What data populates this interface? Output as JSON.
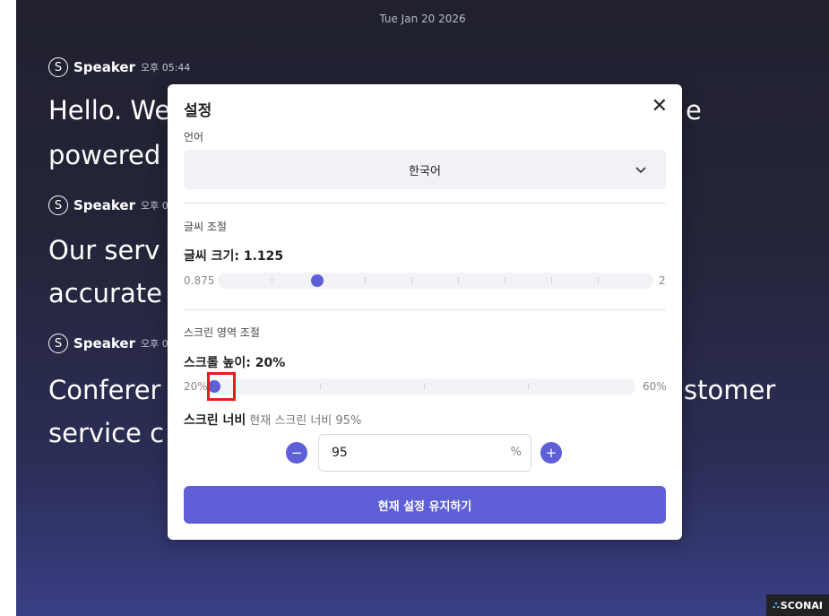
{
  "date": "Tue Jan 20 2026",
  "transcript": [
    {
      "avatar": "S",
      "speaker": "Speaker",
      "time": "오후 05:44",
      "lines": [
        "Hello. We",
        "powered"
      ],
      "line_tail": "e"
    },
    {
      "avatar": "S",
      "speaker": "Speaker",
      "time": "오후 0",
      "lines": [
        "Our serv",
        "accurate"
      ]
    },
    {
      "avatar": "S",
      "speaker": "Speaker",
      "time": "오후 0",
      "lines": [
        "Conferer",
        "service c"
      ],
      "line_tail": "stomer"
    }
  ],
  "settings": {
    "title": "설정",
    "close_icon": "✕",
    "language": {
      "label": "언어",
      "selected": "한국어"
    },
    "font_section": {
      "heading": "글씨 조절",
      "size_label": "글씨 크기: 1.125",
      "min_label": "0.875",
      "max_label": "2",
      "value": 1.125,
      "min": 0.875,
      "max": 2
    },
    "screen_section": {
      "heading": "스크린 영역 조절",
      "scroll_label": "스크롤 높이: 20%",
      "min_label": "20%",
      "max_label": "60%",
      "value": 20,
      "min": 20,
      "max": 60,
      "width_label": "스크린 너비",
      "width_hint": "현재 스크린 너비 95%",
      "width_value": "95",
      "width_unit": "%",
      "minus": "−",
      "plus": "+"
    },
    "keep_button": "현재 설정 유지하기"
  },
  "logo": {
    "mark": "⛬",
    "text": "SCONAI"
  },
  "colors": {
    "accent": "#5e5fd6",
    "highlight": "#e81c1c"
  }
}
